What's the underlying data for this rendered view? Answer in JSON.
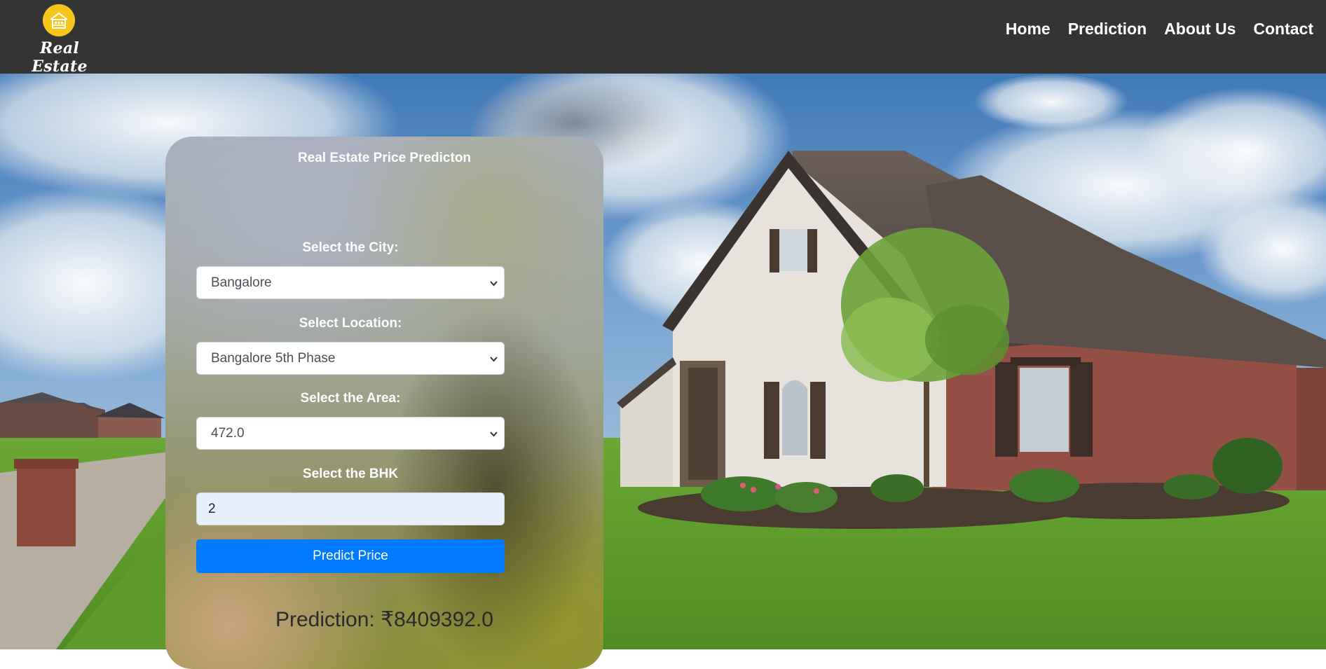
{
  "brand": {
    "name": "Real Estate",
    "logo_icon": "house-icon",
    "logo_color": "#f6c61b"
  },
  "nav": {
    "items": [
      {
        "label": "Home"
      },
      {
        "label": "Prediction"
      },
      {
        "label": "About Us"
      },
      {
        "label": "Contact"
      }
    ]
  },
  "form": {
    "title": "Real Estate Price Predicton",
    "city": {
      "label": "Select the City:",
      "value": "Bangalore"
    },
    "location": {
      "label": "Select Location:",
      "value": "Bangalore 5th Phase"
    },
    "area": {
      "label": "Select the Area:",
      "value": "472.0"
    },
    "bhk": {
      "label": "Select the BHK",
      "value": "2"
    },
    "submit_label": "Predict Price",
    "button_color": "#007bff"
  },
  "result": {
    "text": "Prediction: ₹8409392.0"
  },
  "colors": {
    "navbar": "#343434",
    "text": "#ffffff"
  }
}
